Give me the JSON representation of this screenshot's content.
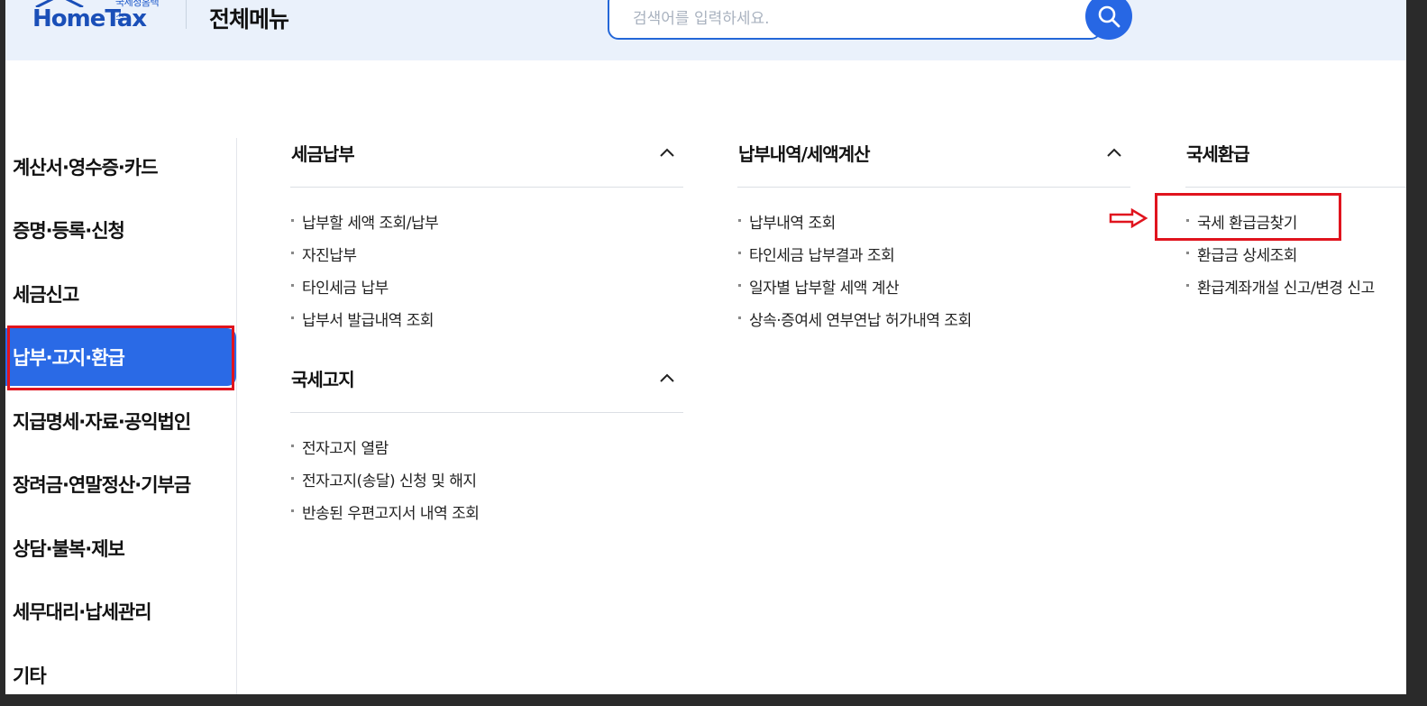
{
  "header": {
    "logo_sub": "국세청홈택스",
    "logo_text": "HomeTax",
    "page_title": "전체메뉴",
    "search_placeholder": "검색어를 입력하세요."
  },
  "sidebar": {
    "items": [
      {
        "label": "계산서·영수증·카드",
        "active": false
      },
      {
        "label": "증명·등록·신청",
        "active": false
      },
      {
        "label": "세금신고",
        "active": false
      },
      {
        "label": "납부·고지·환급",
        "active": true
      },
      {
        "label": "지급명세·자료·공익법인",
        "active": false
      },
      {
        "label": "장려금·연말정산·기부금",
        "active": false
      },
      {
        "label": "상담·불복·제보",
        "active": false
      },
      {
        "label": "세무대리·납세관리",
        "active": false
      },
      {
        "label": "기타",
        "active": false
      }
    ]
  },
  "sections": {
    "tax_payment": {
      "title": "세금납부",
      "items": [
        "납부할 세액 조회/납부",
        "자진납부",
        "타인세금 납부",
        "납부서 발급내역 조회"
      ]
    },
    "tax_notice": {
      "title": "국세고지",
      "items": [
        "전자고지 열람",
        "전자고지(송달) 신청 및 해지",
        "반송된 우편고지서 내역 조회"
      ]
    },
    "payment_history": {
      "title": "납부내역/세액계산",
      "items": [
        "납부내역 조회",
        "타인세금 납부결과 조회",
        "일자별 납부할 세액 계산",
        "상속·증여세 연부연납 허가내역 조회"
      ]
    },
    "tax_refund": {
      "title": "국세환급",
      "items": [
        "국세 환급금찾기",
        "환급금 상세조회",
        "환급계좌개설 신고/변경 신고"
      ]
    }
  },
  "colors": {
    "accent": "#2a6ae6",
    "highlight": "#e0141e",
    "header_bg": "#eaf1fb"
  }
}
